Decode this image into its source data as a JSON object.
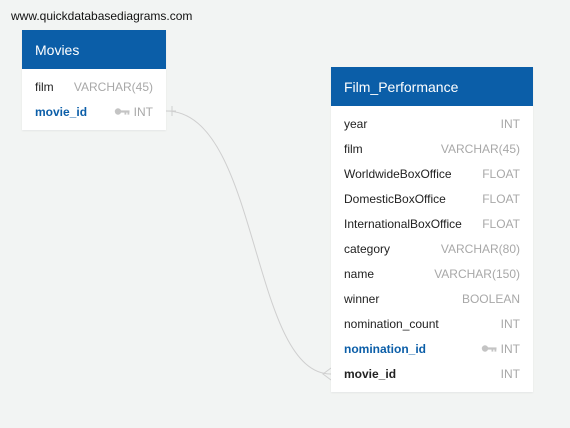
{
  "site_url": "www.quickdatabasediagrams.com",
  "colors": {
    "header": "#0b5ea8",
    "key_field": "#0b5ea8",
    "type_text": "#a8a8a8",
    "connector": "#cfcfcf"
  },
  "tables": {
    "movies": {
      "title": "Movies",
      "fields": [
        {
          "name": "film",
          "type": "VARCHAR(45)"
        },
        {
          "name": "movie_id",
          "type": "INT",
          "icon": "key-icon"
        }
      ]
    },
    "film_performance": {
      "title": "Film_Performance",
      "fields": [
        {
          "name": "year",
          "type": "INT"
        },
        {
          "name": "film",
          "type": "VARCHAR(45)"
        },
        {
          "name": "WorldwideBoxOffice",
          "type": "FLOAT"
        },
        {
          "name": "DomesticBoxOffice",
          "type": "FLOAT"
        },
        {
          "name": "InternationalBoxOffice",
          "type": "FLOAT"
        },
        {
          "name": "category",
          "type": "VARCHAR(80)"
        },
        {
          "name": "name",
          "type": "VARCHAR(150)"
        },
        {
          "name": "winner",
          "type": "BOOLEAN"
        },
        {
          "name": "nomination_count",
          "type": "INT"
        },
        {
          "name": "nomination_id",
          "type": "INT",
          "icon": "key-icon"
        },
        {
          "name": "movie_id",
          "type": "INT"
        }
      ]
    }
  }
}
